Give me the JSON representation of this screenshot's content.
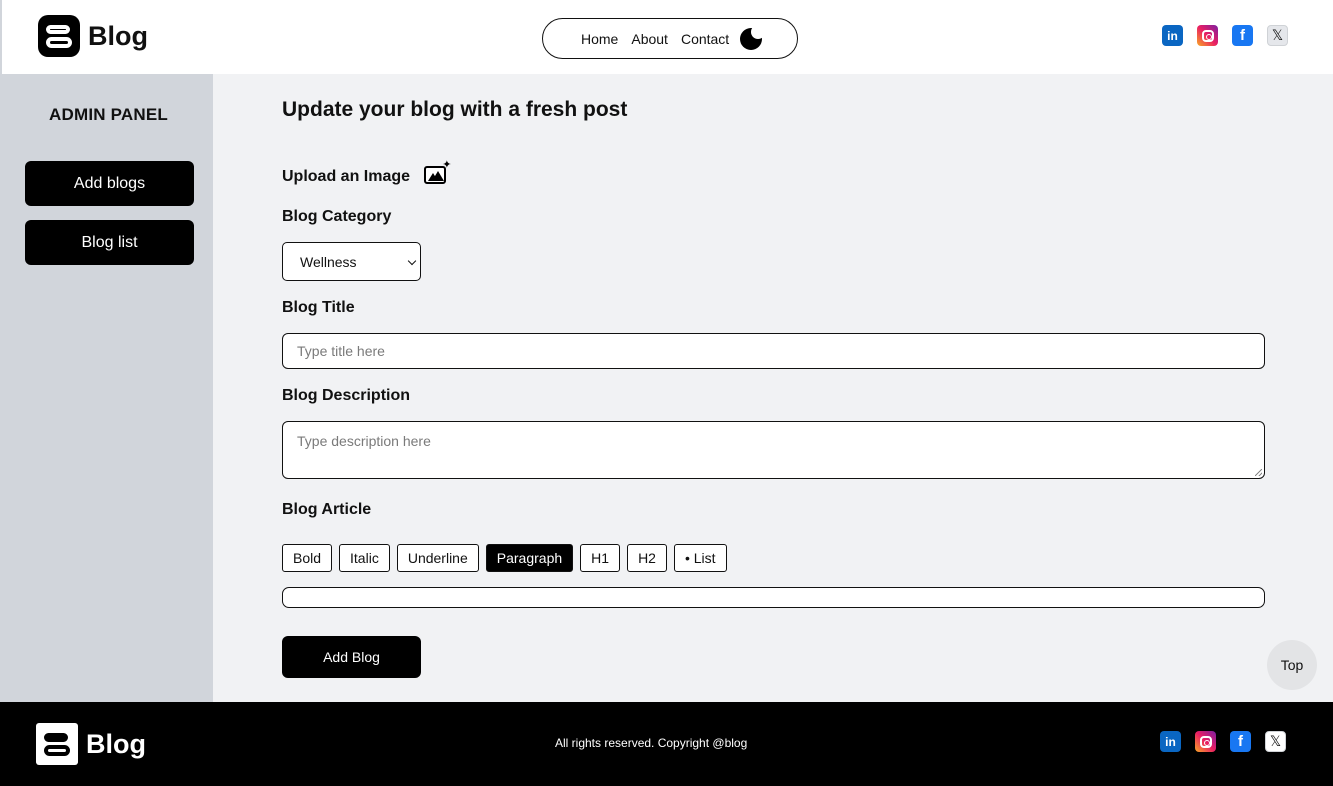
{
  "header": {
    "logo_text": "Blog",
    "nav": [
      {
        "label": "Home"
      },
      {
        "label": "About"
      },
      {
        "label": "Contact"
      }
    ],
    "theme_icon": "moon-icon",
    "socials": [
      {
        "name": "linkedin-icon",
        "glyph": "in"
      },
      {
        "name": "instagram-icon",
        "glyph": ""
      },
      {
        "name": "facebook-icon",
        "glyph": "f"
      },
      {
        "name": "x-icon",
        "glyph": "𝕏"
      }
    ]
  },
  "sidebar": {
    "title": "ADMIN PANEL",
    "items": [
      {
        "label": "Add blogs"
      },
      {
        "label": "Blog list"
      }
    ]
  },
  "main": {
    "title": "Update your blog with a fresh post",
    "upload_label": "Upload an Image",
    "category_label": "Blog Category",
    "category_value": "Wellness",
    "title_label": "Blog Title",
    "title_placeholder": "Type title here",
    "description_label": "Blog Description",
    "description_placeholder": "Type description here",
    "article_label": "Blog Article",
    "toolbar": [
      {
        "label": "Bold",
        "active": false
      },
      {
        "label": "Italic",
        "active": false
      },
      {
        "label": "Underline",
        "active": false
      },
      {
        "label": "Paragraph",
        "active": true
      },
      {
        "label": "H1",
        "active": false
      },
      {
        "label": "H2",
        "active": false
      },
      {
        "label": "• List",
        "active": false
      }
    ],
    "submit_label": "Add Blog",
    "top_label": "Top"
  },
  "footer": {
    "logo_text": "Blog",
    "copyright": "All rights reserved. Copyright @blog"
  },
  "colors": {
    "sidebar_bg": "#d1d5db",
    "main_bg": "#f1f2f4",
    "button_bg": "#000000",
    "footer_bg": "#000000"
  }
}
